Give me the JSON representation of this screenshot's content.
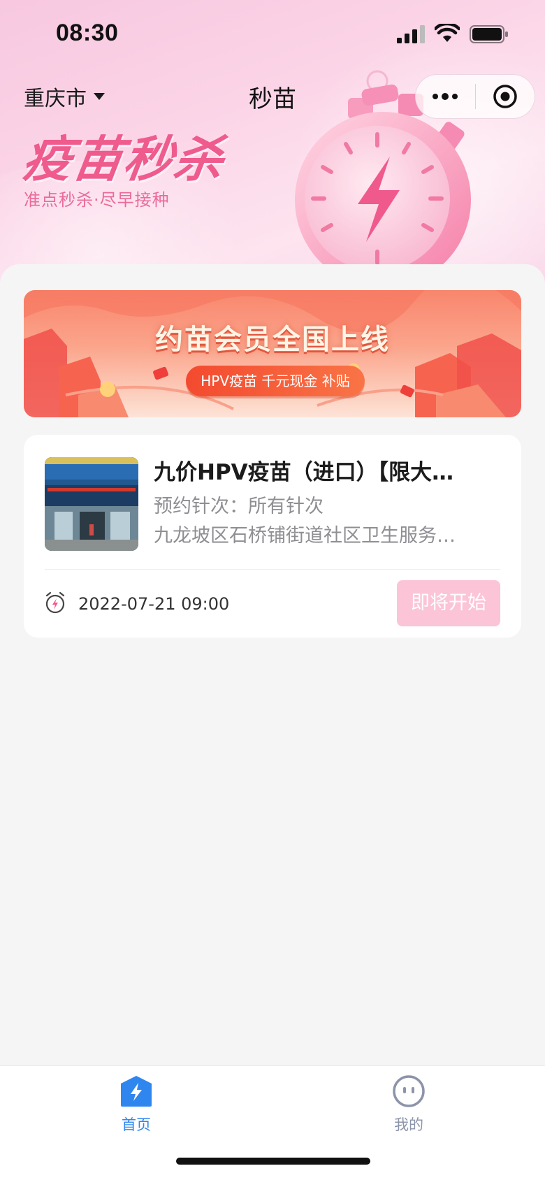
{
  "status_bar": {
    "time": "08:30"
  },
  "header": {
    "city": "重庆市",
    "title": "秒苗",
    "slogan": "疫苗秒杀",
    "sub_slogan": "准点秒杀·尽早接种"
  },
  "banner": {
    "title": "约苗会员全国上线",
    "pill": "HPV疫苗 千元现金 补贴"
  },
  "card": {
    "title": "九价HPV疫苗（进口）【限大…",
    "dose_line": "预约针次：所有针次",
    "clinic_line": "九龙坡区石桥铺街道社区卫生服务…",
    "datetime": "2022-07-21 09:00",
    "button": "即将开始",
    "button_color": "#fcc4d7"
  },
  "tabbar": {
    "items": [
      {
        "label": "首页",
        "icon": "home-bolt-icon",
        "active": true,
        "color": "#2f86ee"
      },
      {
        "label": "我的",
        "icon": "face-icon",
        "active": false,
        "color": "#8b94a8"
      }
    ]
  },
  "colors": {
    "accent_pink": "#ef5b8c",
    "tab_active": "#2f86ee",
    "page_bg": "#f5f5f6"
  }
}
